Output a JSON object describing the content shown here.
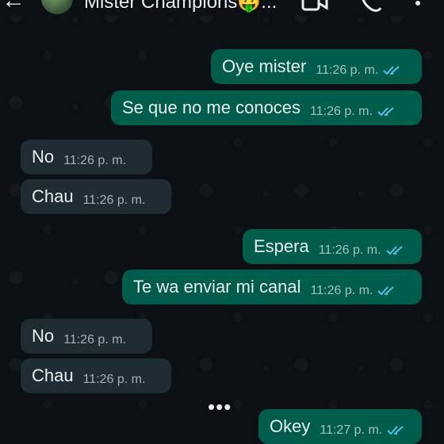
{
  "header": {
    "title": "Mister Champions🤑..."
  },
  "messages": [
    {
      "dir": "out",
      "text": "Oye mister",
      "time": "11:26 p. m."
    },
    {
      "dir": "out",
      "text": "Se que no me conoces",
      "time": "11:26 p. m."
    },
    {
      "dir": "in",
      "text": "No",
      "time": "11:26 p. m."
    },
    {
      "dir": "in",
      "text": "Chau",
      "time": "11:26 p. m."
    },
    {
      "dir": "out",
      "text": "Espera",
      "time": "11:26 p. m."
    },
    {
      "dir": "out",
      "text": "Te wa enviar mi canal",
      "time": "11:26 p. m."
    },
    {
      "dir": "in",
      "text": "No",
      "time": "11:26 p. m."
    },
    {
      "dir": "in",
      "text": "Chau",
      "time": "11:26 p. m."
    },
    {
      "dir": "out",
      "text": "Okey",
      "time": "11:27 p. m."
    }
  ],
  "typing_indicator": "•••",
  "colors": {
    "outgoing_bubble": "#005c4b",
    "incoming_bubble": "#202c33",
    "read_ticks": "#53bdeb",
    "background": "#0b1014"
  }
}
